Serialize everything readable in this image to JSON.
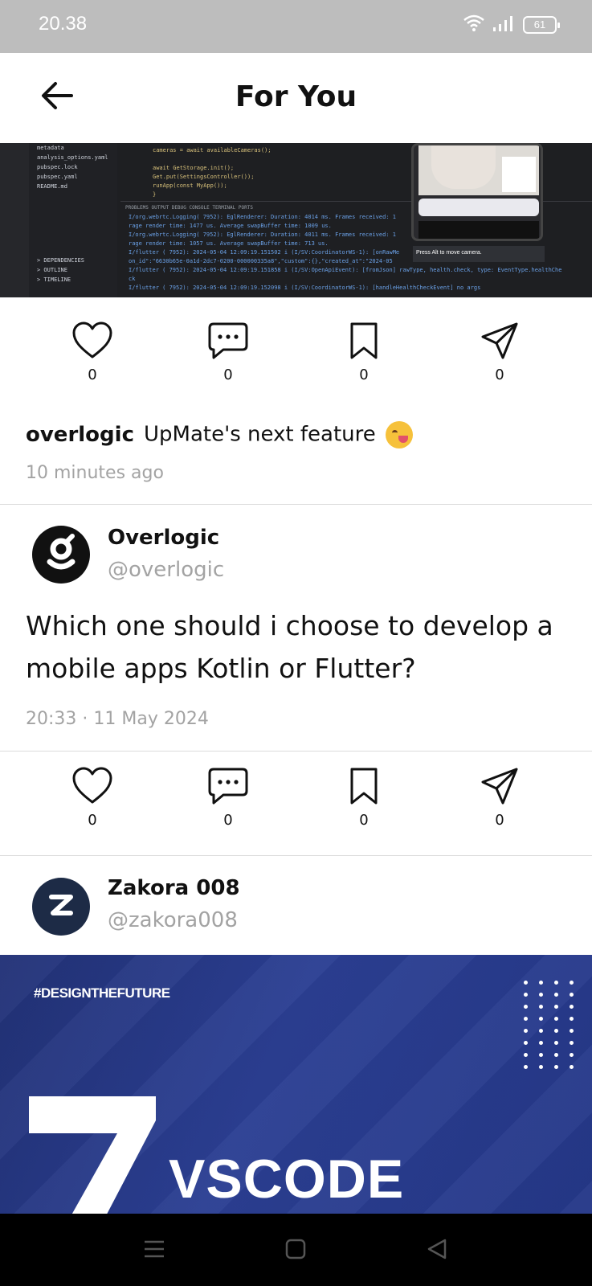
{
  "status_bar": {
    "time": "20.38",
    "battery": "61",
    "icons": [
      "wifi-icon",
      "signal-icon",
      "battery-icon"
    ]
  },
  "header": {
    "title": "For You",
    "back_icon": "arrow-left-icon"
  },
  "post1": {
    "image_content": {
      "file_tree": [
        "metadata",
        "analysis_options.yaml",
        "pubspec.lock",
        "pubspec.yaml",
        "README.md"
      ],
      "file_tree_bottom": [
        "> DEPENDENCIES",
        "> OUTLINE",
        "> TIMELINE"
      ],
      "code_lines": [
        "cameras = await availableCameras();",
        "",
        "await GetStorage.init();",
        "Get.put(SettingsController());",
        "runApp(const MyApp());",
        "}"
      ],
      "console_tabs": "PROBLEMS  OUTPUT  DEBUG CONSOLE  TERMINAL  PORTS",
      "console_lines": [
        "I/org.webrtc.Logging( 7952): EglRenderer: Duration: 4014 ms. Frames received: 1",
        "rage render time: 1477 us. Average swapBuffer time: 1009 us.",
        "I/org.webrtc.Logging( 7952): EglRenderer: Duration: 4011 ms. Frames received: 1",
        "rage render time: 1057 us. Average swapBuffer time: 713 us.",
        "I/flutter ( 7952): 2024-05-04 12:09:19.151502 i (I/SV:CoordinatorWS-1): [onRawMe",
        "on_id\":\"6630b65e-0a1d-2dc7-0200-000000335a8\",\"custom\":{},\"created_at\":\"2024-05",
        "I/flutter ( 7952): 2024-05-04 12:09:19.151858 i (I/SV:OpenApiEvent): [fromJson] rawType, health.check, type: EventType.healthChe",
        "ck",
        "I/flutter ( 7952): 2024-05-04 12:09:19.152098 i (I/SV:CoordinatorWS-1): [handleHealthCheckEvent] no args"
      ],
      "tooltip": "Press Alt to move camera."
    },
    "actions": [
      {
        "icon": "heart-icon",
        "count": "0"
      },
      {
        "icon": "comment-icon",
        "count": "0"
      },
      {
        "icon": "bookmark-icon",
        "count": "0"
      },
      {
        "icon": "send-icon",
        "count": "0"
      }
    ],
    "username": "overlogic",
    "caption": "UpMate's next feature",
    "caption_emoji": "yum-emoji-icon",
    "time_ago": "10 minutes ago"
  },
  "post2": {
    "display_name": "Overlogic",
    "handle": "@overlogic",
    "text": "Which one should i choose to develop a mobile apps Kotlin or Flutter?",
    "timestamp": "20:33 · 11 May 2024",
    "actions": [
      {
        "icon": "heart-icon",
        "count": "0"
      },
      {
        "icon": "comment-icon",
        "count": "0"
      },
      {
        "icon": "bookmark-icon",
        "count": "0"
      },
      {
        "icon": "send-icon",
        "count": "0"
      }
    ]
  },
  "post3": {
    "display_name": "Zakora 008",
    "handle": "@zakora008",
    "banner": {
      "hashtag": "#DESIGNTHEFUTURE",
      "big_number": "7",
      "word": "VSCODE",
      "bg_color": "#283b8c"
    }
  },
  "nav_bar": {
    "icons": [
      "menu-icon",
      "home-square-icon",
      "back-triangle-icon"
    ]
  }
}
